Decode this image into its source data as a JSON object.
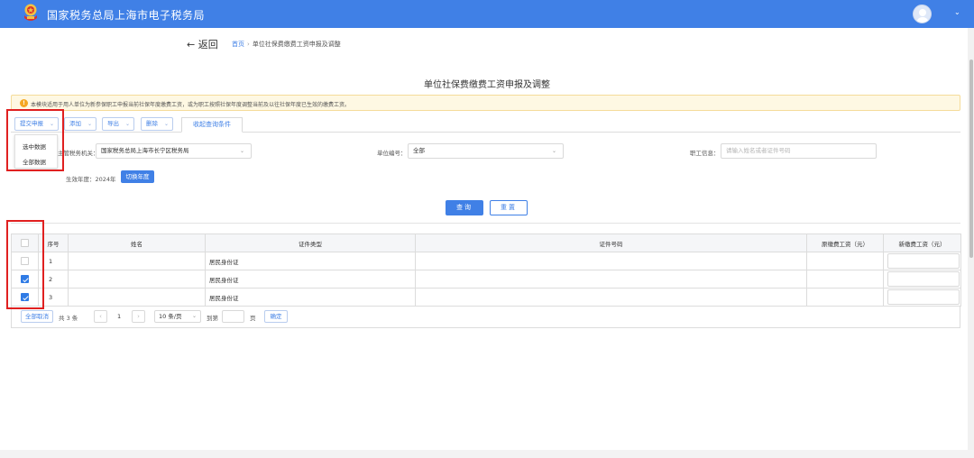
{
  "header": {
    "brand": "国家税务总局上海市电子税务局",
    "chevron": "⌄"
  },
  "nav": {
    "back_label": "← 返回",
    "breadcrumb": {
      "home": "首页",
      "separator": "›",
      "current": "单位社保费缴费工资申报及调整"
    }
  },
  "page": {
    "title": "单位社保费缴费工资申报及调整",
    "notice": "本模块适用于用人单位为新参保职工申报当前社保年度缴费工资，或为职工按照社保年度调整当前及以往社保年度已生效的缴费工资。",
    "notice_icon": "!"
  },
  "toolbar": {
    "report_label": "提交申报",
    "add_label": "添加",
    "export_label": "导出",
    "delete_label": "删除",
    "collapse_tab_label": "收起查询条件",
    "chevron": "⌄"
  },
  "report_dropdown": {
    "items": [
      "选中数据",
      "全部数据"
    ]
  },
  "filters": {
    "tax_office_label": "主管税务机关：",
    "tax_office_value": "国家税务总局上海市长宁区税务局",
    "unit_no_label": "单位编号：",
    "unit_no_value": "全部",
    "employee_label": "职工信息：",
    "employee_placeholder": "请输入姓名或者证件号码",
    "year_label": "生效年度：2024年",
    "switch_year_label": "切换年度",
    "query_label": "查询",
    "reset_label": "重置"
  },
  "table": {
    "headers": {
      "seq": "序号",
      "name": "姓名",
      "id_type": "证件类型",
      "id_number": "证件号码",
      "orig_salary": "原缴费工资（元）",
      "new_salary": "新缴费工资（元）"
    },
    "rows": [
      {
        "seq": "1",
        "name": "",
        "id_type": "居民身份证",
        "id_number": "",
        "orig_salary": "",
        "checked": false
      },
      {
        "seq": "2",
        "name": "",
        "id_type": "居民身份证",
        "id_number": "",
        "orig_salary": "",
        "checked": true
      },
      {
        "seq": "3",
        "name": "",
        "id_type": "居民身份证",
        "id_number": "",
        "orig_salary": "",
        "checked": true
      }
    ]
  },
  "pager": {
    "select_all_label": "全部取消",
    "total_label": "共 3 条",
    "prev": "‹",
    "page": "1",
    "next": "›",
    "page_size": "10 条/页",
    "goto_label": "到第",
    "page_unit": "页",
    "confirm_label": "确定"
  },
  "colors": {
    "brand_blue": "#4080e6",
    "highlight_red": "#e02020",
    "notice_bg": "#fef8e3"
  }
}
